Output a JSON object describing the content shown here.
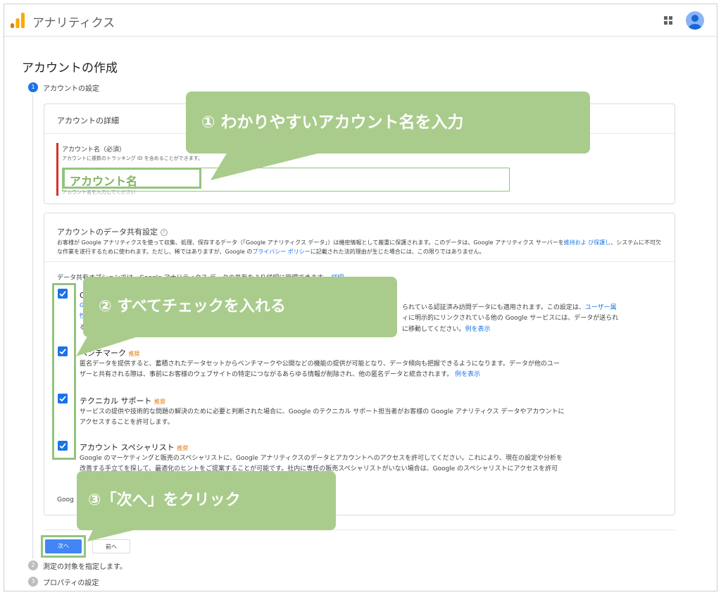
{
  "app": {
    "title": "アナリティクス"
  },
  "page": {
    "title": "アカウントの作成"
  },
  "steps": [
    {
      "number": "1",
      "label": "アカウントの設定"
    },
    {
      "number": "2",
      "label": "測定の対象を指定します。"
    },
    {
      "number": "3",
      "label": "プロパティの設定"
    }
  ],
  "account_details": {
    "heading": "アカウントの詳細",
    "name_label": "アカウント名（必須）",
    "name_help": "アカウントに複数のトラッキング ID を含めることができます。",
    "name_value": "アカウント名",
    "name_error": "アカウント名を入力してください"
  },
  "sharing": {
    "heading": "アカウントのデータ共有設定",
    "desc_1": "お客様が Google アナリティクスを使って収集、処理、保存するデータ（「Google アナリティクス データ」）は機密情報として厳重に保護されます。このデータは、Google アナリティクス サーバーを",
    "desc_link_1": "維持およ び保護し",
    "desc_2": "、システムに不可欠な作業を遂行するために使われます。ただし、稀ではありますが、Google の",
    "desc_link_2": "プライバシー ポリシー",
    "desc_3": "に記載された法的理由が生じた場合には、この限りではありません。",
    "options_intro": "データ共有オプションでは、Google アナリティクス データの共有をより詳細に管理できます。",
    "options_intro_link": "詳細",
    "option_1": {
      "title_partial": "G",
      "line_1_partial": "られている認証済み訪問データにも適用されます。この設定は、",
      "line_1_link": "ユーザー属",
      "line_1_lead": "Googl",
      "line_2_lead": "性",
      "line_2_partial": "ィに明示的にリンクされている他の Google サービスには、データが送られ",
      "line_3_lead": "る",
      "line_3_partial": "に移動してください。",
      "line_3_link": "例を表示"
    },
    "option_2": {
      "title": "ベンチマーク",
      "badge": "推奨",
      "line_1": "匿名データを提供すると、蓄積されたデータセットからベンチマークや公開などの機能の提供が可能となり、データ傾向も把握できるようになります。データが他のユー",
      "line_2": "ザーと共有される際は、事前にお客様のウェブサイトの特定につながるあらゆる情報が削除され、他の匿名データと統合されます。",
      "link": "例を表示"
    },
    "option_3": {
      "title": "テクニカル サポート",
      "badge": "推奨",
      "line_1": "サービスの提供や技術的な問題の解決のために必要と判断された場合に、Google のテクニカル サポート担当者がお客様の Google アナリティクス データやアカウントに",
      "line_2": "アクセスすることを許可します。"
    },
    "option_4": {
      "title": "アカウント スペシャリスト",
      "badge": "推奨",
      "line_1": "Google のマーケティングと販売のスペシャリストに、Google アナリティクスのデータとアカウントへのアクセスを許可してください。これにより、現在の設定や分析を",
      "line_2": "改善する手立てを探して、最適化のヒントをご提案することが可能です。社内に専任の販売スペシャリストがいない場合は、Google のスペシャリストにアクセスを許可"
    },
    "footer_partial": "Goog"
  },
  "buttons": {
    "next": "次へ",
    "prev": "前へ"
  },
  "annotations": {
    "callout_1": "① わかりやすいアカウント名を入力",
    "callout_2": "② すべてチェックを入れる",
    "callout_3": "③「次へ」をクリック"
  },
  "colors": {
    "accent": "#1a73e8",
    "callout": "#a9cc8c",
    "highlight": "#92c47d",
    "recommended": "#e37400",
    "error": "#d93025"
  }
}
